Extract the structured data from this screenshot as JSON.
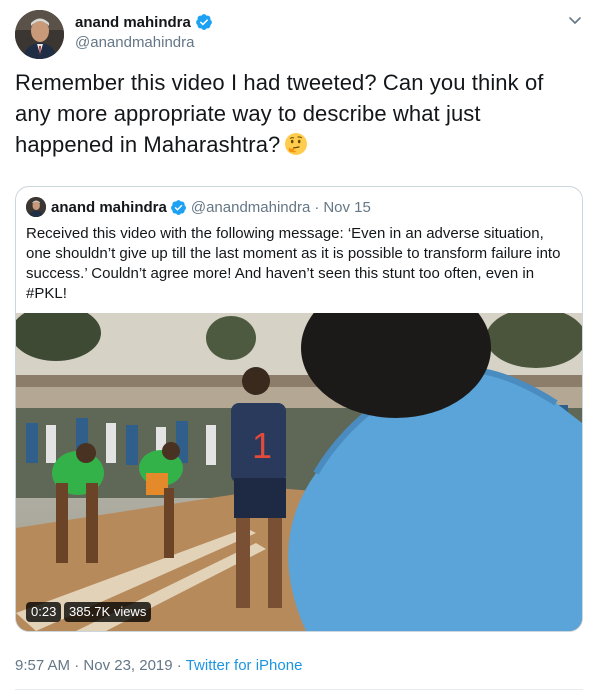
{
  "author": {
    "name": "anand mahindra",
    "handle": "@anandmahindra",
    "avatar_icon": "profile-photo",
    "verified_icon": "verified-badge-icon"
  },
  "tweet": {
    "text": "Remember this video I had tweeted? Can you think of any more appropriate way to describe what just happened in Maharashtra?",
    "emoji": "thinking-face-emoji"
  },
  "quoted": {
    "name": "anand mahindra",
    "handle": "@anandmahindra",
    "separator": "·",
    "date": "Nov 15",
    "text": "Received this video with the following message: ‘Even in an adverse situation, one shouldn’t give up till the last moment as it is possible to transform failure into success.’ Couldn’t agree more! And haven’t seen this stunt too often, even in #PKL!",
    "video": {
      "duration": "0:23",
      "views": "385.7K views"
    }
  },
  "meta": {
    "time": "9:57 AM",
    "separator1": " · ",
    "date": "Nov 23, 2019",
    "separator2": " · ",
    "source": "Twitter for iPhone"
  },
  "colors": {
    "text": "#14171a",
    "secondary": "#657786",
    "link": "#1b95e0",
    "verified": "#1da1f2",
    "border": "#ccd6dd"
  }
}
